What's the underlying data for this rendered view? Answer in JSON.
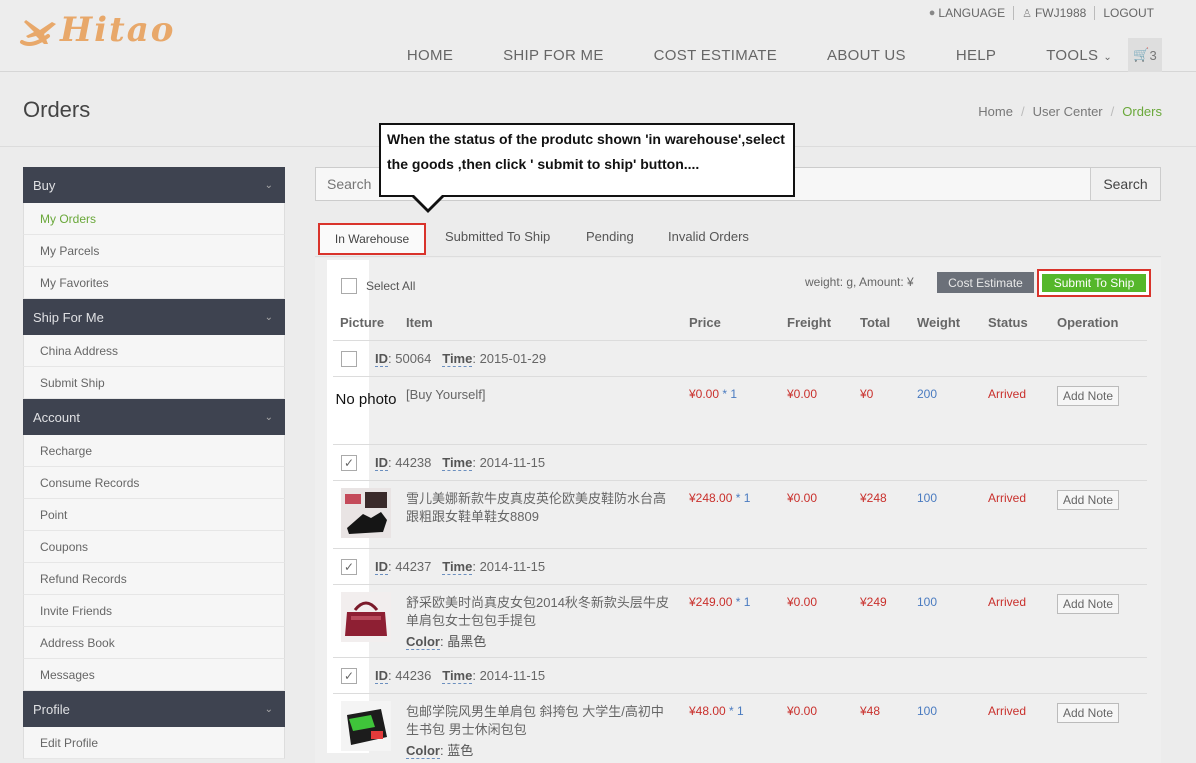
{
  "header": {
    "logo_text": "Hitao",
    "topbar": {
      "language": "LANGUAGE",
      "user": "FWJ1988",
      "logout": "LOGOUT"
    },
    "nav": [
      "HOME",
      "SHIP FOR ME",
      "COST ESTIMATE",
      "ABOUT US",
      "HELP",
      "TOOLS"
    ],
    "cart_count": "3"
  },
  "page": {
    "title": "Orders",
    "breadcrumb": [
      "Home",
      "User Center",
      "Orders"
    ]
  },
  "sidebar": {
    "groups": [
      {
        "title": "Buy",
        "items": [
          "My Orders",
          "My Parcels",
          "My Favorites"
        ]
      },
      {
        "title": "Ship For Me",
        "items": [
          "China Address",
          "Submit Ship"
        ]
      },
      {
        "title": "Account",
        "items": [
          "Recharge",
          "Consume Records",
          "Point",
          "Coupons",
          "Refund Records",
          "Invite Friends",
          "Address Book",
          "Messages"
        ]
      },
      {
        "title": "Profile",
        "items": [
          "Edit Profile"
        ]
      }
    ]
  },
  "search": {
    "placeholder": "Search",
    "button": "Search"
  },
  "tabs": [
    "In Warehouse",
    "Submitted To Ship",
    "Pending",
    "Invalid Orders"
  ],
  "toolbar": {
    "select_all": "Select All",
    "weight_info": "weight: g, Amount: ¥",
    "cost_estimate": "Cost Estimate",
    "submit": "Submit To Ship"
  },
  "table": {
    "headers": [
      "Picture",
      "Item",
      "Price",
      "Freight",
      "Total",
      "Weight",
      "Status",
      "Operation"
    ],
    "no_photo": "No photo",
    "note_label": "Add Note",
    "id_label": "ID",
    "time_label": "Time",
    "color_label": "Color",
    "orders": [
      {
        "id": "50064",
        "time": "2015-01-29",
        "checked": false,
        "item": "[Buy Yourself]",
        "color": "",
        "price": "¥0.00",
        "qty": "* 1",
        "freight": "¥0.00",
        "total": "¥0",
        "weight": "200",
        "status": "Arrived"
      },
      {
        "id": "44238",
        "time": "2014-11-15",
        "checked": true,
        "item": "雪儿美娜新款牛皮真皮英伦欧美皮鞋防水台高跟粗跟女鞋单鞋女8809",
        "color": "",
        "price": "¥248.00",
        "qty": "* 1",
        "freight": "¥0.00",
        "total": "¥248",
        "weight": "100",
        "status": "Arrived"
      },
      {
        "id": "44237",
        "time": "2014-11-15",
        "checked": true,
        "item": "舒采欧美时尚真皮女包2014秋冬新款头层牛皮单肩包女士包包手提包",
        "color": "晶黑色",
        "price": "¥249.00",
        "qty": "* 1",
        "freight": "¥0.00",
        "total": "¥249",
        "weight": "100",
        "status": "Arrived"
      },
      {
        "id": "44236",
        "time": "2014-11-15",
        "checked": true,
        "item": "包邮学院风男生单肩包 斜挎包 大学生/高初中生书包 男士休闲包包",
        "color": "蓝色",
        "price": "¥48.00",
        "qty": "* 1",
        "freight": "¥0.00",
        "total": "¥48",
        "weight": "100",
        "status": "Arrived"
      }
    ]
  },
  "callout": "When the status of the produtc shown 'in warehouse',select the goods ,then click ' submit to ship' button....",
  "colors": {
    "sidebar_header": "#3e4350",
    "accent_green": "#55b72a",
    "highlight_red": "#d9332b",
    "price_red": "#c9302c"
  }
}
